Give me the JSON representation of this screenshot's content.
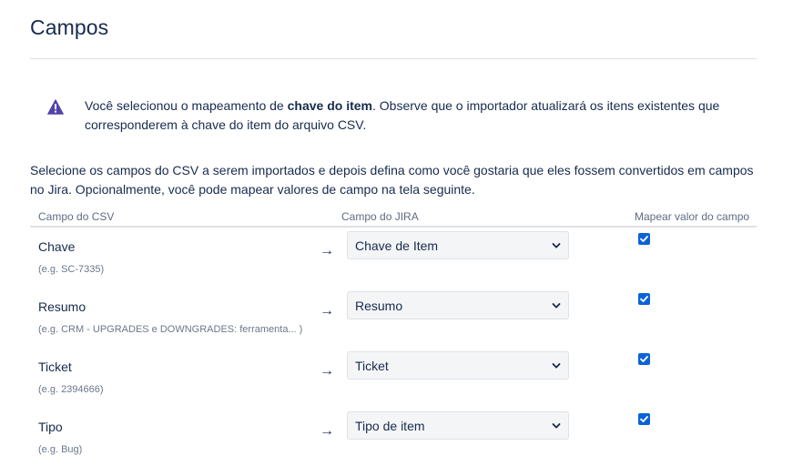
{
  "page": {
    "title": "Campos"
  },
  "warning": {
    "text_before": "Você selecionou o mapeamento de ",
    "text_bold": "chave do item",
    "text_after": ". Observe que o importador atualizará os itens existentes que corresponderem à chave do item do arquivo CSV.",
    "icon": "warning-triangle-icon",
    "icon_color": "#5243aa"
  },
  "intro": "Selecione os campos do CSV a serem importados e depois defina como você gostaria que eles fossem convertidos em campos no Jira. Opcionalmente, você pode mapear valores de campo na tela seguinte.",
  "table": {
    "headers": {
      "csv": "Campo do CSV",
      "jira": "Campo do JIRA",
      "map": "Mapear valor do campo"
    },
    "rows": [
      {
        "name": "Chave",
        "example": "(e.g. SC-7335)",
        "arrow": "→",
        "jira_field": "Chave de Item",
        "map_value": true
      },
      {
        "name": "Resumo",
        "example": "(e.g. CRM - UPGRADES e DOWNGRADES: ferramenta... )",
        "arrow": "→",
        "jira_field": "Resumo",
        "map_value": true
      },
      {
        "name": "Ticket",
        "example": "(e.g. 2394666)",
        "arrow": "→",
        "jira_field": "Ticket",
        "map_value": true
      },
      {
        "name": "Tipo",
        "example": "(e.g. Bug)",
        "arrow": "→",
        "jira_field": "Tipo de item",
        "map_value": true
      }
    ]
  },
  "colors": {
    "checkbox": "#0b63d6",
    "text": "#172b4d",
    "muted": "#6b778c"
  }
}
